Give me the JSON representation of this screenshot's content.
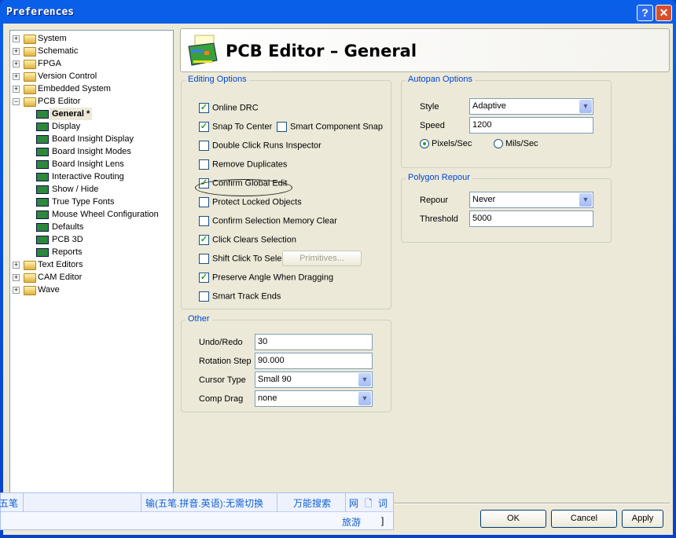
{
  "window": {
    "title": "Preferences",
    "help": "?",
    "close": "✕"
  },
  "tree": [
    {
      "label": "System",
      "type": "folder",
      "exp": "+"
    },
    {
      "label": "Schematic",
      "type": "folder",
      "exp": "+"
    },
    {
      "label": "FPGA",
      "type": "folder",
      "exp": "+"
    },
    {
      "label": "Version Control",
      "type": "folder",
      "exp": "+"
    },
    {
      "label": "Embedded System",
      "type": "folder",
      "exp": "+"
    },
    {
      "label": "PCB Editor",
      "type": "folder",
      "exp": "−"
    },
    {
      "label": "General *",
      "type": "page",
      "selected": true
    },
    {
      "label": "Display",
      "type": "page"
    },
    {
      "label": "Board Insight Display",
      "type": "page"
    },
    {
      "label": "Board Insight Modes",
      "type": "page"
    },
    {
      "label": "Board Insight Lens",
      "type": "page"
    },
    {
      "label": "Interactive Routing",
      "type": "page"
    },
    {
      "label": "Show / Hide",
      "type": "page"
    },
    {
      "label": "True Type Fonts",
      "type": "page"
    },
    {
      "label": "Mouse Wheel Configuration",
      "type": "page"
    },
    {
      "label": "Defaults",
      "type": "page"
    },
    {
      "label": "PCB 3D",
      "type": "page"
    },
    {
      "label": "Reports",
      "type": "page"
    },
    {
      "label": "Text Editors",
      "type": "folder",
      "exp": "+"
    },
    {
      "label": "CAM Editor",
      "type": "folder",
      "exp": "+"
    },
    {
      "label": "Wave",
      "type": "folder",
      "exp": "+"
    }
  ],
  "header": {
    "title": "PCB Editor – General"
  },
  "editing": {
    "legend": "Editing Options",
    "items": [
      {
        "label": "Online DRC",
        "checked": true
      },
      {
        "label": "Snap To Center",
        "checked": true
      },
      {
        "label": "Double Click Runs Inspector",
        "checked": false
      },
      {
        "label": "Remove Duplicates",
        "checked": false
      },
      {
        "label": "Confirm Global Edit",
        "checked": true
      },
      {
        "label": "Protect Locked Objects",
        "checked": false
      },
      {
        "label": "Confirm Selection Memory Clear",
        "checked": false
      },
      {
        "label": "Click Clears Selection",
        "checked": true
      },
      {
        "label": "Shift Click To Select",
        "checked": false
      },
      {
        "label": "Preserve Angle When Dragging",
        "checked": true
      },
      {
        "label": "Smart Track Ends",
        "checked": false
      }
    ],
    "smart_component_snap": {
      "label": "Smart Component Snap",
      "checked": false
    },
    "primitives": "Primitives..."
  },
  "other": {
    "legend": "Other",
    "undo_label": "Undo/Redo",
    "undo": "30",
    "rot_label": "Rotation Step",
    "rot": "90.000",
    "cursor_label": "Cursor Type",
    "cursor": "Small 90",
    "drag_label": "Comp Drag",
    "drag": "none"
  },
  "autopan": {
    "legend": "Autopan Options",
    "style_label": "Style",
    "style": "Adaptive",
    "speed_label": "Speed",
    "speed": "1200",
    "pixels": "Pixels/Sec",
    "mils": "Mils/Sec",
    "selected": "Pixels/Sec"
  },
  "polygon": {
    "legend": "Polygon Repour",
    "repour_label": "Repour",
    "repour": "Never",
    "thr_label": "Threshold",
    "thr": "5000"
  },
  "buttons": {
    "ok": "OK",
    "cancel": "Cancel",
    "apply": "Apply"
  },
  "ime": {
    "mode": "五笔",
    "hint": "输(五笔.拼音.英语):无需切换",
    "search": "万能搜索",
    "net": "网",
    "word": "词",
    "travel": "旅游",
    "bracket": "]"
  }
}
